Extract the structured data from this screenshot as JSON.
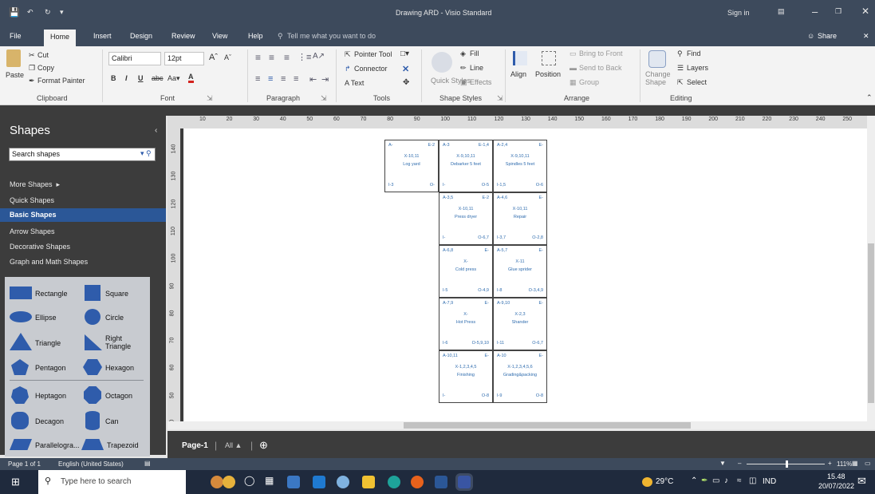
{
  "window": {
    "title": "Drawing ARD - Visio Standard",
    "signin": "Sign in"
  },
  "tabs": [
    "File",
    "Home",
    "Insert",
    "Design",
    "Review",
    "View",
    "Help"
  ],
  "tell_me": "Tell me what you want to do",
  "share": "Share",
  "ribbon": {
    "clipboard": {
      "cut": "Cut",
      "copy": "Copy",
      "paste": "Paste",
      "format_painter": "Format Painter",
      "label": "Clipboard"
    },
    "font": {
      "family": "Calibri",
      "size": "12pt",
      "label": "Font"
    },
    "paragraph": {
      "label": "Paragraph"
    },
    "tools": {
      "pointer": "Pointer Tool",
      "connector": "Connector",
      "text": "A Text",
      "label": "Tools"
    },
    "styles": {
      "quick": "Quick Styles",
      "fill": "Fill",
      "line": "Line",
      "effects": "Effects",
      "label": "Shape Styles"
    },
    "arrange": {
      "align": "Align",
      "position": "Position",
      "bring_front": "Bring to Front",
      "send_back": "Send to Back",
      "group": "Group",
      "label": "Arrange"
    },
    "editing": {
      "change_shape": "Change Shape",
      "find": "Find",
      "layers": "Layers",
      "select": "Select",
      "label": "Editing"
    }
  },
  "shapes_pane": {
    "title": "Shapes",
    "search_placeholder": "Search shapes",
    "links": [
      "More Shapes",
      "Quick Shapes",
      "Basic Shapes",
      "Arrow Shapes",
      "Decorative Shapes",
      "Graph and Math Shapes"
    ],
    "stencil": [
      "Rectangle",
      "Square",
      "Ellipse",
      "Circle",
      "Triangle",
      "Right Triangle",
      "Pentagon",
      "Hexagon",
      "Heptagon",
      "Octagon",
      "Decagon",
      "Can",
      "Parallelogra...",
      "Trapezoid"
    ]
  },
  "ruler_top": [
    "10",
    "20",
    "30",
    "40",
    "50",
    "60",
    "70",
    "80",
    "90",
    "100",
    "110",
    "120",
    "130",
    "140",
    "150",
    "160",
    "170",
    "180",
    "190",
    "200",
    "210",
    "220",
    "230",
    "240",
    "250"
  ],
  "ruler_left": [
    "140",
    "130",
    "120",
    "110",
    "100",
    "90",
    "80",
    "70",
    "60",
    "50",
    "40"
  ],
  "cells": [
    {
      "tl": "A-",
      "tr": "E-2",
      "x": "X-10,11",
      "name": "Log yard",
      "bl": "I-3",
      "br": "O-"
    },
    {
      "tl": "A-3",
      "tr": "E-1,4",
      "x": "X-9,10,11",
      "name": "Debarker 5 feet",
      "bl": "I-",
      "br": "O-5"
    },
    {
      "tl": "A-2,4",
      "tr": "E-",
      "x": "X-9,10,11",
      "name": "Spindles 5 feet",
      "bl": "I-1,5",
      "br": "O-6"
    },
    {
      "tl": "A-3,5",
      "tr": "E-2",
      "x": "X-10,11",
      "name": "Press dryer",
      "bl": "I-",
      "br": "O-6,7"
    },
    {
      "tl": "A-4,6",
      "tr": "E-",
      "x": "X-10,11",
      "name": "Repair",
      "bl": "I-3,7",
      "br": "O-2,8"
    },
    {
      "tl": "A-6,8",
      "tr": "E-",
      "x": "X-",
      "name": "Cold press",
      "bl": "I-5",
      "br": "O-4,9"
    },
    {
      "tl": "A-5,7",
      "tr": "E-",
      "x": "X-11",
      "name": "Glue sprider",
      "bl": "I-8",
      "br": "O-3,4,9"
    },
    {
      "tl": "A-7,9",
      "tr": "E-",
      "x": "X-",
      "name": "Hot Press",
      "bl": "I-6",
      "br": "O-5,9,10"
    },
    {
      "tl": "A-9,10",
      "tr": "E-",
      "x": "X-2,3",
      "name": "Shander",
      "bl": "I-11",
      "br": "O-6,7"
    },
    {
      "tl": "A-10,11",
      "tr": "E-",
      "x": "X-1,2,3,4,5",
      "name": "Finishing",
      "bl": "I-",
      "br": "O-8"
    },
    {
      "tl": "A-10",
      "tr": "E-",
      "x": "X-1,2,3,4,5,6",
      "name": "Grading&packing",
      "bl": "I-9",
      "br": "O-8"
    }
  ],
  "page_tabs": {
    "page": "Page-1",
    "all": "All"
  },
  "status": {
    "page": "Page 1 of 1",
    "lang": "English (United States)",
    "zoom": "111%"
  },
  "taskbar": {
    "search": "Type here to search",
    "weather": "29°C",
    "lang": "IND",
    "time": "15.48",
    "date": "20/07/2022"
  }
}
